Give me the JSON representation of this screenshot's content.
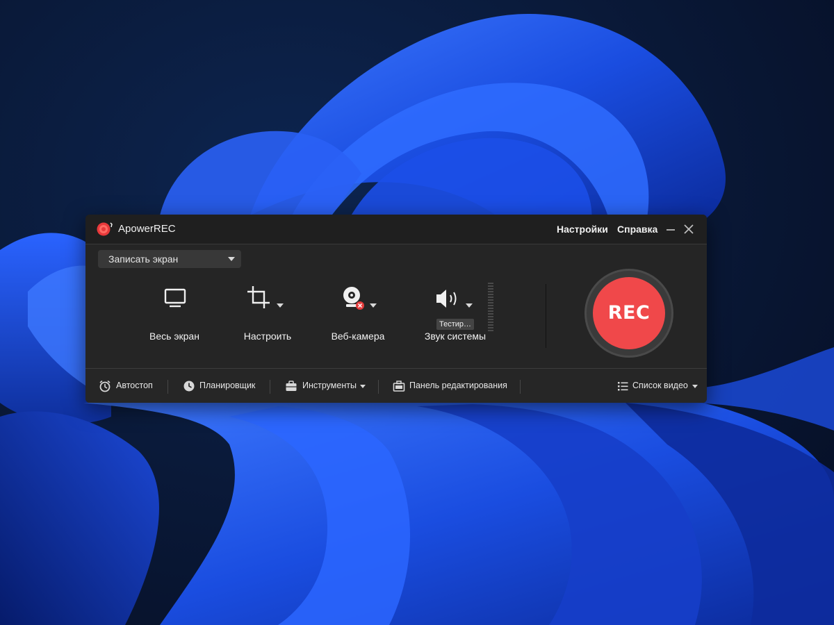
{
  "app": {
    "title": "ApowerREC",
    "menu_settings": "Настройки",
    "menu_help": "Справка"
  },
  "mode_select": {
    "selected": "Записать экран"
  },
  "tools": {
    "full_screen": "Весь экран",
    "custom": "Настроить",
    "webcam": "Веб-камера",
    "system_sound": "Звук системы",
    "sound_tooltip": "Тестир…"
  },
  "rec_button": {
    "label": "REC"
  },
  "bottom_bar": {
    "autostop": "Автостоп",
    "scheduler": "Планировщик",
    "tools": "Инструменты",
    "edit_panel": "Панель редактирования",
    "video_list": "Список видео"
  },
  "icons": {
    "logo": "apowerrec-logo-icon",
    "minimize": "minimize-icon",
    "close": "close-icon",
    "monitor": "monitor-icon",
    "crop": "crop-icon",
    "webcam": "webcam-icon",
    "speaker": "speaker-icon",
    "alarm": "alarm-clock-icon",
    "clock": "clock-icon",
    "toolbox": "toolbox-icon",
    "briefcase": "briefcase-icon",
    "list": "list-icon"
  },
  "colors": {
    "rec_red": "#f0484a",
    "window_bg": "#252525",
    "titlebar_bg": "#1f1f1f",
    "wallpaper_blue": "#1a4de0"
  }
}
